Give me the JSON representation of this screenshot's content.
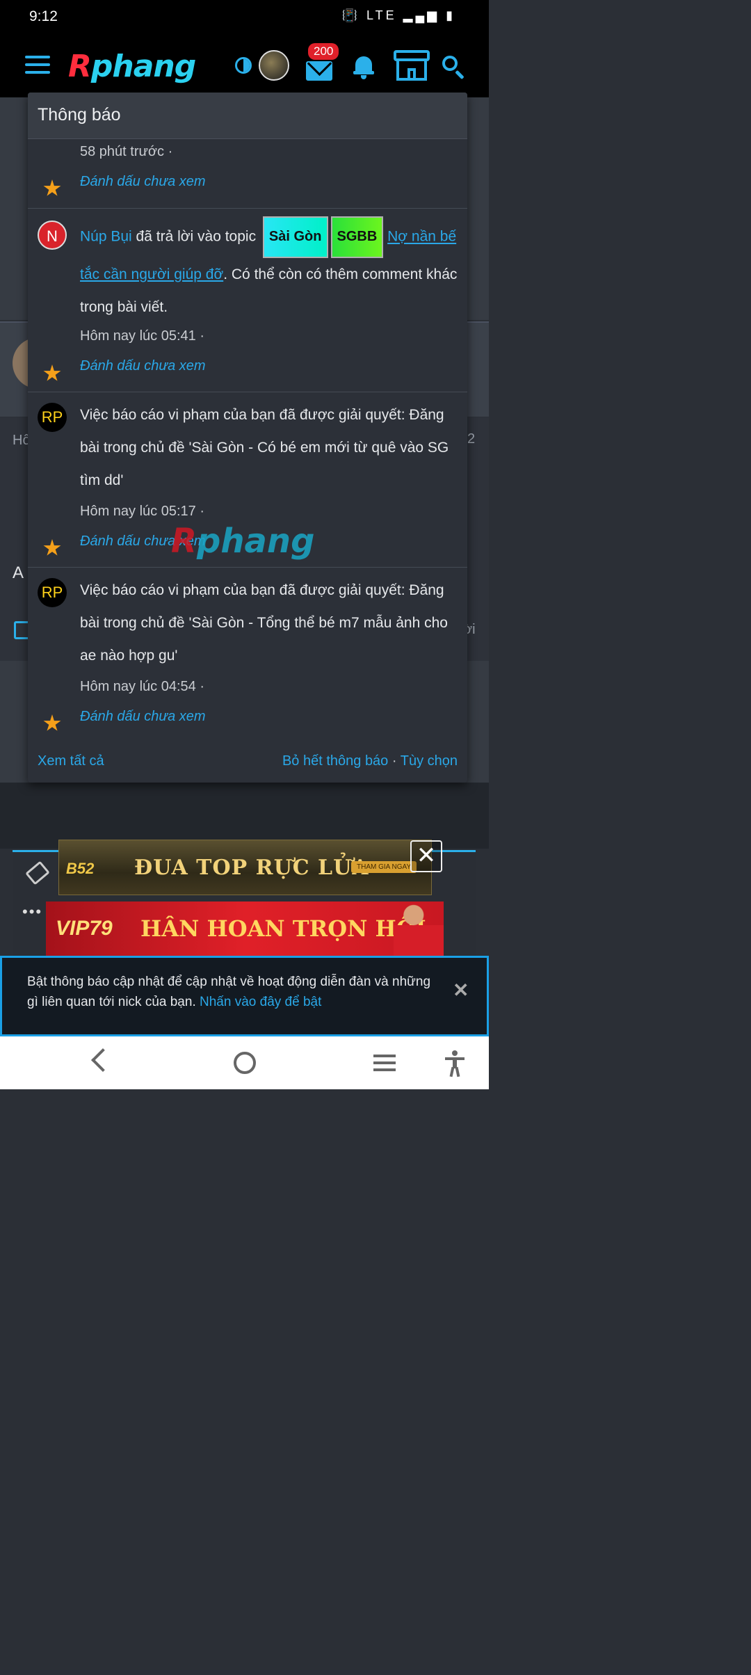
{
  "status_bar": {
    "time": "9:12",
    "indicators": "📳 LTE ▂▄▆ ▮"
  },
  "header": {
    "logo_r": "R",
    "logo_rest": "phang",
    "mail_badge": "200"
  },
  "popup": {
    "title": "Thông báo",
    "items": [
      {
        "time": "58 phút trước ·",
        "mark": "Đánh dấu chưa xem"
      },
      {
        "avatar": "N",
        "user": "Núp Bụi",
        "action": " đã trả lời vào topic ",
        "tag1": "Sài Gòn",
        "tag2": "SGBB",
        "topic": "Nợ nần bế tắc cần người giúp đỡ",
        "suffix": ". Có thể còn có thêm comment khác trong bài viết.",
        "time": "Hôm nay lúc 05:41 ·",
        "mark": "Đánh dấu chưa xem"
      },
      {
        "avatar": "RP",
        "text": "Việc báo cáo vi phạm của bạn đã được giải quyết: Đăng bài trong chủ đề 'Sài Gòn - Có bé em mới từ quê vào SG tìm dd'",
        "time": "Hôm nay lúc 05:17 ·",
        "mark": "Đánh dấu chưa xem"
      },
      {
        "avatar": "RP",
        "text": "Việc báo cáo vi phạm của bạn đã được giải quyết: Đăng bài trong chủ đề 'Sài Gòn - Tổng thể bé m7 mẫu ảnh cho ae nào hợp gu'",
        "time": "Hôm nay lúc 04:54 ·",
        "mark": "Đánh dấu chưa xem"
      }
    ],
    "footer": {
      "view_all": "Xem tất cả",
      "dismiss": "Bỏ hết thông báo",
      "sep": " · ",
      "options": "Tùy chọn"
    }
  },
  "watermark": {
    "r": "R",
    "rest": "phang"
  },
  "background": {
    "left_text": "Hô",
    "right_num": "2",
    "letter": "A",
    "right_text": "ời"
  },
  "ads": {
    "ad1_brand": "B52",
    "ad1_text": "ĐUA TOP RỰC LỬA",
    "ad1_cta": "THAM GIA NGAY",
    "ad2_brand": "VIP79",
    "ad2_text": "HÂN HOAN TRỌN HỘI",
    "close_glyph": "✕"
  },
  "push_banner": {
    "text": "Bật thông báo cập nhật để cập nhật về hoạt động diễn đàn và những gì liên quan tới nick của bạn. ",
    "link": "Nhấn vào đây để bật",
    "close": "✕"
  },
  "icons": [
    "hamburger-icon",
    "theme-toggle-icon",
    "mail-icon",
    "bell-icon",
    "store-icon",
    "search-icon",
    "star-icon",
    "eraser-icon",
    "back-icon",
    "home-icon",
    "recent-apps-icon",
    "accessibility-icon"
  ],
  "colors": {
    "accent": "#2bb0ea",
    "star": "#f5a01a",
    "badge": "#e0202a"
  }
}
